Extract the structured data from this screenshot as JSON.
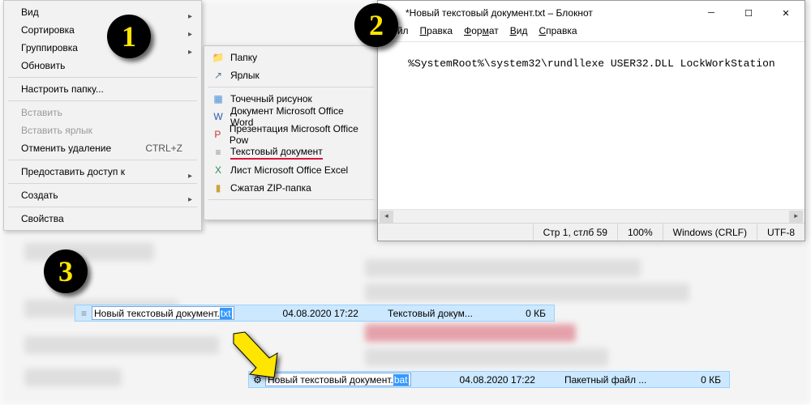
{
  "context_menu": {
    "items": [
      {
        "label": "Вид",
        "arrow": true
      },
      {
        "label": "Сортировка",
        "arrow": true
      },
      {
        "label": "Группировка",
        "arrow": true
      },
      {
        "label": "Обновить"
      }
    ],
    "items2": [
      {
        "label": "Настроить папку..."
      }
    ],
    "items3": [
      {
        "label": "Вставить",
        "disabled": true
      },
      {
        "label": "Вставить ярлык",
        "disabled": true
      },
      {
        "label": "Отменить удаление",
        "hotkey": "CTRL+Z"
      }
    ],
    "items4": [
      {
        "label": "Предоставить доступ к",
        "arrow": true
      }
    ],
    "items5": [
      {
        "label": "Создать",
        "arrow": true
      }
    ],
    "items6": [
      {
        "label": "Свойства"
      }
    ]
  },
  "submenu": {
    "top": [
      {
        "icon": "folder",
        "label": "Папку"
      },
      {
        "icon": "shortcut",
        "label": "Ярлык"
      }
    ],
    "bottom": [
      {
        "icon": "bmp",
        "label": "Точечный рисунок"
      },
      {
        "icon": "word",
        "label": "Документ Microsoft Office Word"
      },
      {
        "icon": "ppt",
        "label": "Презентация Microsoft Office Pow"
      },
      {
        "icon": "txt",
        "label": "Текстовый документ",
        "underline": true
      },
      {
        "icon": "excel",
        "label": "Лист Microsoft Office Excel"
      },
      {
        "icon": "zip",
        "label": "Сжатая ZIP-папка"
      }
    ]
  },
  "notepad": {
    "title": "*Новый текстовый документ.txt – Блокнот",
    "menu": {
      "file": "Файл",
      "edit": "Правка",
      "format": "Формат",
      "view": "Вид",
      "help": "Справка"
    },
    "content": "%SystemRoot%\\system32\\rundllexe USER32.DLL LockWorkStation",
    "status": {
      "pos": "Стр 1, стлб 59",
      "zoom": "100%",
      "eol": "Windows (CRLF)",
      "enc": "UTF-8"
    }
  },
  "file_rows": {
    "txt": {
      "name_base": "Новый текстовый документ.",
      "ext": "txt",
      "date": "04.08.2020 17:22",
      "type": "Текстовый докум...",
      "size": "0 КБ"
    },
    "bat": {
      "name_base": "Новый текстовый документ.",
      "ext": "bat",
      "date": "04.08.2020 17:22",
      "type": "Пакетный файл ...",
      "size": "0 КБ"
    }
  },
  "badges": {
    "one": "1",
    "two": "2",
    "three": "3"
  }
}
